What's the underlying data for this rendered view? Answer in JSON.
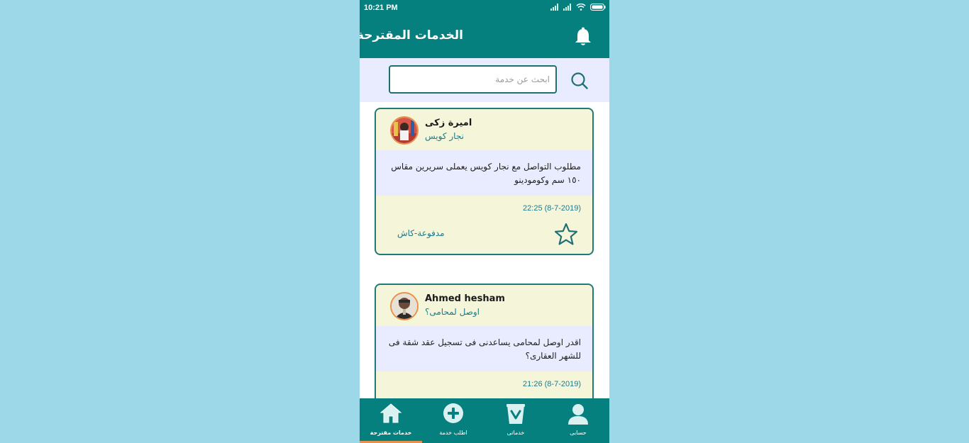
{
  "status_bar": {
    "time": "10:21 PM"
  },
  "app_bar": {
    "title": "الخدمات المقترحة"
  },
  "search": {
    "placeholder": "ابحث عن خدمة"
  },
  "posts": [
    {
      "name": "اميرة زكى",
      "subtitle": "نجار كويس",
      "body": "مطلوب التواصل مع نجار كويس يعملى سريرين مقاس ١٥٠ سم وكومودينو",
      "date": "22:25 (8-7-2019)",
      "payment": "مدفوعة-كاش"
    },
    {
      "name": "Ahmed hesham",
      "subtitle": "اوصل لمحامى؟",
      "body": "اقدر اوصل لمحامى يساعدنى فى تسجيل عقد شقة فى للشهر العقارى؟",
      "date": "21:26 (8-7-2019)"
    }
  ],
  "bottom_nav": [
    {
      "label": "خدمات مقترحة",
      "icon": "home-icon",
      "active": true
    },
    {
      "label": "اطلب خدمة",
      "icon": "add-circle-icon",
      "active": false
    },
    {
      "label": "خدماتى",
      "icon": "bag-icon",
      "active": false
    },
    {
      "label": "حسابى",
      "icon": "user-icon",
      "active": false
    }
  ],
  "colors": {
    "primary": "#06807f",
    "card_background": "#f5f5d9",
    "card_body": "#e9ecff",
    "accent": "#e8914a",
    "page_background": "#9dd8e8"
  }
}
